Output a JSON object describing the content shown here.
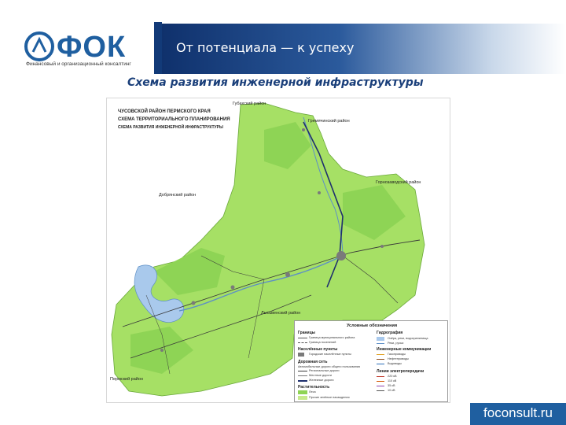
{
  "header": {
    "logo_text": "ФОК",
    "logo_subtitle": "Финансовый и организационный консалтинг",
    "slogan": "От потенциала — к успеху"
  },
  "page_title": "Схема развития инженерной инфраструктуры",
  "map": {
    "heading_lines": [
      "ЧУСОВСКОЙ РАЙОН ПЕРМСКОГО КРАЯ",
      "СХЕМА ТЕРРИТОРИАЛЬНОГО ПЛАНИРОВАНИЯ",
      "СХЕМА РАЗВИТИЯ ИНЖЕНЕРНОЙ ИНФРАСТРУКТУРЫ"
    ],
    "neighbor_labels": {
      "top": "Губахский район",
      "top_right": "Гремячинский район",
      "right": "Горнозаводский район",
      "left": "Добрянский район",
      "bottom_center": "Лысьвенский район",
      "bottom_left": "Пермский район"
    },
    "legend": {
      "title": "Условные обозначения",
      "sections": {
        "borders": "Границы",
        "settlements": "Населённые пункты",
        "roads": "Дорожная сеть",
        "vegetation": "Растительность",
        "hydrography": "Гидрография",
        "engineering": "Инженерные коммуникации",
        "power": "Линии электропередачи"
      },
      "items": {
        "border_district": "Граница муниципального района",
        "border_settlement": "Граница поселений",
        "settlement_1": "Городские населённые пункты",
        "road_1": "Автомобильные дороги общего пользования",
        "road_2": "Региональные дороги",
        "road_3": "Местные дороги",
        "rail": "Железные дороги",
        "forest": "Леса",
        "meadow": "Прочие зелёные насаждения",
        "water_1": "Озёра, реки, водохранилища",
        "water_2": "Реки, ручьи",
        "eng_1": "Газопроводы",
        "eng_2": "Нефтепроводы",
        "eng_3": "Водоводы",
        "pw_1": "220 кВ",
        "pw_2": "110 кВ",
        "pw_3": "35 кВ",
        "pw_4": "10 кВ"
      },
      "colors": {
        "forest": "#8ed455",
        "meadow": "#c6ea8c",
        "water": "#a9c9ec",
        "settlement": "#7a7a7a"
      }
    },
    "colors": {
      "land": "#a6e065",
      "land_dark": "#8ed455",
      "river": "#a9c9ec",
      "roads": "#3a3a3a",
      "rail": "#1e2f6e"
    }
  },
  "footer": {
    "brand": "foconsult.ru"
  }
}
